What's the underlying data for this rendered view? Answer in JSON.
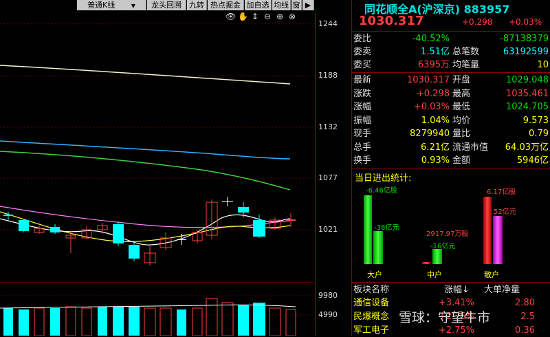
{
  "toolbar": {
    "kline_label": "普通K线",
    "dropdown_icon": "▼",
    "buttons": [
      "龙头回溯",
      "九转",
      "热点掘金",
      "加自选",
      "均线",
      "窗"
    ],
    "arrow_icon": "▶"
  },
  "chart_tools": [
    "👁",
    "✋",
    "↕",
    "⊖",
    "⊕",
    "⊗"
  ],
  "price_axis": [
    "1244",
    "1188",
    "1132",
    "1077",
    "1021"
  ],
  "volume_axis": [
    "9980",
    "4990"
  ],
  "quote": {
    "title": "同花顺全A(沪深京) 883957",
    "price": "1030.317",
    "change": "+0.298",
    "change_pct": "+0.03%",
    "rows1": [
      {
        "label": "委比",
        "v1": "-40.52%",
        "v1c": "green",
        "v2": "-87138379",
        "v2c": "green"
      },
      {
        "label": "委卖",
        "v1": "1.51亿",
        "v1c": "cyan",
        "l2": "总笔数",
        "v2": "63192599",
        "v2c": "cyan"
      },
      {
        "label": "委买",
        "v1": "6395万",
        "v1c": "red",
        "l2": "均笔量",
        "v2": "10",
        "v2c": "yellow"
      }
    ],
    "rows2": [
      {
        "label": "最新",
        "v1": "1030.317",
        "v1c": "red",
        "l2": "开盘",
        "v2": "1029.048",
        "v2c": "green"
      },
      {
        "label": "涨跌",
        "v1": "+0.298",
        "v1c": "red",
        "l2": "最高",
        "v2": "1035.461",
        "v2c": "red"
      },
      {
        "label": "涨幅",
        "v1": "+0.03%",
        "v1c": "red",
        "l2": "最低",
        "v2": "1024.705",
        "v2c": "green"
      },
      {
        "label": "振幅",
        "v1": "1.04%",
        "v1c": "yellow",
        "l2": "均价",
        "v2": "9.573",
        "v2c": "yellow"
      },
      {
        "label": "现手",
        "v1": "8279940",
        "v1c": "yellow",
        "l2": "量比",
        "v2": "0.79",
        "v2c": "yellow"
      },
      {
        "label": "总手",
        "v1": "6.21亿",
        "v1c": "yellow",
        "l2": "流通市值",
        "v2": "64.03万亿",
        "v2c": "yellow"
      },
      {
        "label": "换手",
        "v1": "0.93%",
        "v1c": "yellow",
        "l2": "金额",
        "v2": "5946亿",
        "v2c": "yellow"
      }
    ],
    "flow": {
      "title": "当日进出统计:",
      "big_in": "-6.46亿股",
      "big_out": "-38亿元",
      "mid_in": "2917.97万股",
      "mid_out": "-16亿元",
      "retail_in": "6.17亿股",
      "retail_out": "52亿元",
      "labels": [
        "大户",
        "中户",
        "散户"
      ]
    },
    "sector_header": [
      "板块名称",
      "涨幅",
      "大单净量"
    ],
    "sector_sort_icon": "↓",
    "sectors": [
      {
        "name": "通信设备",
        "pct": "+3.41%",
        "net": "2.80"
      },
      {
        "name": "民爆概念",
        "pct": "+2.75%",
        "net": "2.5"
      },
      {
        "name": "军工电子",
        "pct": "+2.75%",
        "net": "0.36"
      }
    ]
  },
  "watermark": "雪球：守望牛市"
}
